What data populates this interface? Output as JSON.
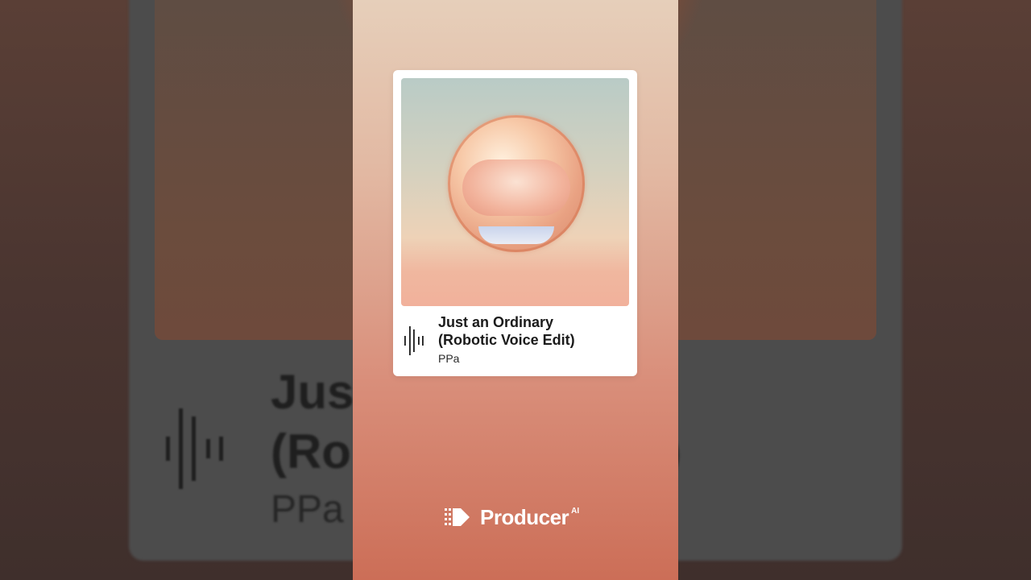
{
  "track": {
    "title_line1": "Just an Ordinary",
    "title_line2": "(Robotic Voice Edit)",
    "artist": "PPa"
  },
  "background": {
    "title_line1": "Jus",
    "title_line2": "(Ro                   dit)",
    "artist": "PPa"
  },
  "brand": {
    "name": "Producer",
    "superscript": "AI"
  },
  "icons": {
    "waveform": "waveform-icon",
    "brand_logo": "producer-logo-icon"
  },
  "colors": {
    "card_bg": "#ffffff",
    "gradient_top": "#e6cfba",
    "gradient_bottom": "#cc6e57",
    "text_dark": "#1b1b1b"
  }
}
